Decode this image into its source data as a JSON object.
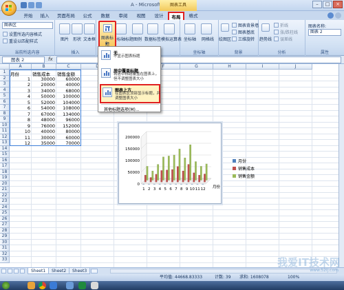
{
  "window": {
    "title": "A - Microsoft Excel",
    "context_tab": "图表工具"
  },
  "tabs": [
    "开始",
    "插入",
    "页面布局",
    "公式",
    "数据",
    "审阅",
    "视图",
    "设计",
    "布局",
    "格式"
  ],
  "ribbon": {
    "selection_name": "图表区",
    "format_selection": "设置所选内容格式",
    "reset_style": "重设以匹配样式",
    "group_current": "当前所选内容",
    "insert_picture": "图片",
    "insert_shapes": "形状",
    "insert_textbox": "文本框",
    "group_insert": "插入",
    "chart_title": "图表标题",
    "axis_title": "坐标轴标题",
    "legend": "图例",
    "data_labels": "数据标签",
    "data_table": "模拟运算表",
    "axes": "坐标轴",
    "gridlines": "网格线",
    "group_axes": "坐标轴",
    "plot_area": "绘图区",
    "chart_wall": "图表背景墙",
    "chart_floor": "图表基底",
    "rotation_3d": "三维旋转",
    "group_background": "背景",
    "trendline": "趋势线",
    "lines": "折线",
    "updown_bars": "涨/跌柱线",
    "error_bars": "误差线",
    "group_analysis": "分析",
    "chart_name_label": "图表名称:",
    "chart_name_value": "图表 2",
    "group_properties": "属性"
  },
  "formula_bar": {
    "name_box": "图表 2",
    "fx": "fx",
    "formula": ""
  },
  "dropdown": {
    "items": [
      {
        "title": "无",
        "desc": "不显示图表标题"
      },
      {
        "title": "居中覆盖标题",
        "desc": "将居中标题覆盖在图表上，但不调整图表大小"
      },
      {
        "title": "图表上方",
        "desc": "在图表区顶部显示标题，并调整图表大小"
      }
    ],
    "more": "其他标题选项(M)..."
  },
  "sheet": {
    "columns": [
      "A",
      "B",
      "C",
      "D",
      "E",
      "F",
      "G",
      "H",
      "I",
      "J"
    ],
    "headers": [
      "月份",
      "销售成本",
      "销售金额"
    ],
    "rows": [
      [
        "1",
        "30000",
        "60000"
      ],
      [
        "2",
        "20000",
        "40000"
      ],
      [
        "3",
        "34000",
        "68000"
      ],
      [
        "4",
        "50000",
        "100000"
      ],
      [
        "5",
        "52000",
        "104000"
      ],
      [
        "6",
        "54000",
        "108000"
      ],
      [
        "7",
        "67000",
        "134000"
      ],
      [
        "8",
        "48000",
        "96000"
      ],
      [
        "9",
        "76000",
        "152000"
      ],
      [
        "10",
        "40000",
        "80000"
      ],
      [
        "11",
        "30000",
        "60000"
      ],
      [
        "12",
        "35000",
        "70000"
      ]
    ]
  },
  "chart_data": {
    "type": "bar",
    "title": "",
    "xlabel": "",
    "ylabel": "",
    "categories": [
      "1",
      "2",
      "3",
      "4",
      "5",
      "6",
      "7",
      "8",
      "9",
      "10",
      "11",
      "12"
    ],
    "series": [
      {
        "name": "月份",
        "values": [
          1,
          2,
          3,
          4,
          5,
          6,
          7,
          8,
          9,
          10,
          11,
          12
        ],
        "color": "#4f81bd"
      },
      {
        "name": "销售成本",
        "values": [
          30000,
          20000,
          34000,
          50000,
          52000,
          54000,
          67000,
          48000,
          76000,
          40000,
          30000,
          35000
        ],
        "color": "#c0504d"
      },
      {
        "name": "销售金额",
        "values": [
          60000,
          40000,
          68000,
          100000,
          104000,
          108000,
          134000,
          96000,
          152000,
          80000,
          60000,
          70000
        ],
        "color": "#9bbb59"
      }
    ],
    "ylim": [
      0,
      200000
    ],
    "yticks": [
      "200000",
      "150000",
      "100000",
      "50000",
      "0"
    ],
    "x_axis_label": "月份",
    "grid": true,
    "legend_position": "right"
  },
  "sheet_tabs": [
    "Sheet1",
    "Sheet2",
    "Sheet3"
  ],
  "status": {
    "average": "平均值: 44668.83333",
    "count": "计数: 39",
    "sum": "求和: 1608078",
    "zoom": "100%"
  },
  "watermark": {
    "text": "我爱IT技术网",
    "url": "www.52ij.com"
  }
}
